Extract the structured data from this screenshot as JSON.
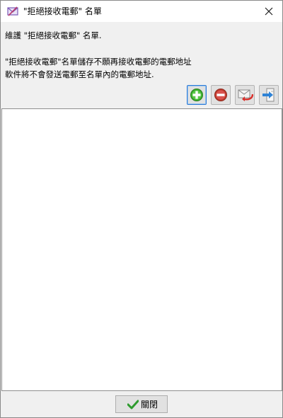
{
  "window": {
    "title": "\"拒絕接收電郵\" 名單",
    "title_icon": "envelope-block-icon",
    "close_icon": "close-icon"
  },
  "instructions": {
    "line1": "維護 \"拒絕接收電郵\" 名單.",
    "line2": "\"拒絕接收電郵\"名單儲存不願再接收電郵的電郵地址",
    "line3": "軟件將不會發送電郵至名單內的電郵地址."
  },
  "toolbar": {
    "buttons": [
      {
        "icon": "add-icon",
        "color": "#3cae2f"
      },
      {
        "icon": "remove-icon",
        "color": "#c0392b"
      },
      {
        "icon": "import-icon",
        "color": "#d9302c"
      },
      {
        "icon": "export-icon",
        "color": "#2f83d6"
      }
    ]
  },
  "list": {
    "items": []
  },
  "footer": {
    "close_label": "關閉",
    "check_icon": "checkmark-icon",
    "check_color": "#2e9b2e"
  }
}
